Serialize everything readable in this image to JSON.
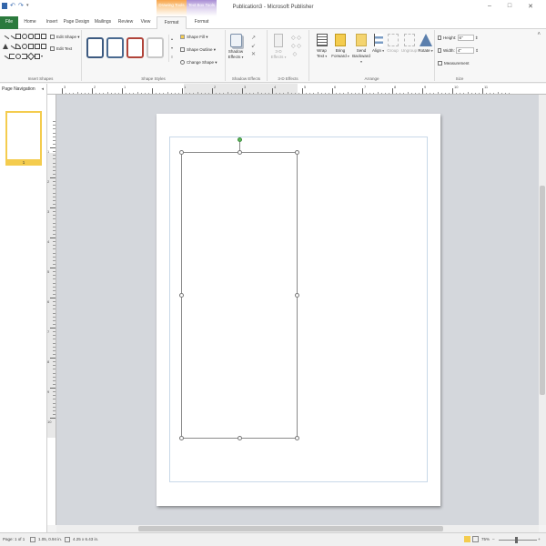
{
  "window": {
    "title": "Publication3 - Microsoft Publisher",
    "contextual_tabs": [
      "Drawing Tools",
      "Text Box Tools"
    ],
    "controls": [
      "minimize-icon",
      "restore-icon",
      "close-icon"
    ]
  },
  "tabs": [
    {
      "label": "File"
    },
    {
      "label": "Home"
    },
    {
      "label": "Insert"
    },
    {
      "label": "Page Design"
    },
    {
      "label": "Mailings"
    },
    {
      "label": "Review"
    },
    {
      "label": "View"
    },
    {
      "label": "Format"
    },
    {
      "label": "Format"
    }
  ],
  "ribbon": {
    "insert_shapes": {
      "label": "Insert Shapes",
      "edit_shape": "Edit Shape",
      "edit_text": "Edit Text"
    },
    "shape_styles": {
      "label": "Shape Styles",
      "swatch_colors": [
        "#3d5a80",
        "#4a6a90",
        "#b0443a",
        "#c8c8c8"
      ],
      "shape_fill": "Shape Fill",
      "shape_outline": "Shape Outline",
      "change_shape": "Change Shape"
    },
    "shadow_effects": {
      "label": "Shadow Effects",
      "button": "Shadow Effects"
    },
    "effects_3d": {
      "label": "3-D Effects",
      "button": "3-D Effects"
    },
    "arrange": {
      "label": "Arrange",
      "wrap_text": "Wrap Text",
      "bring_forward": "Bring Forward",
      "send_backward": "Send Backward",
      "align": "Align",
      "group": "Group",
      "ungroup": "Ungroup",
      "rotate": "Rotate"
    },
    "size": {
      "label": "Size",
      "height_label": "Height:",
      "height_value": "6\"",
      "width_label": "Width:",
      "width_value": "4\"",
      "measurement": "Measurement"
    }
  },
  "nav_pane": {
    "title": "Page Navigation",
    "page_number": "1"
  },
  "ruler": {
    "h_labels": [
      "3",
      "2",
      "1",
      "",
      "1",
      "2",
      "3",
      "4",
      "5",
      "6",
      "7",
      "8",
      "9",
      "10",
      "11"
    ],
    "v_labels": [
      "1",
      "2",
      "3",
      "4",
      "5",
      "6",
      "7",
      "8",
      "9",
      "10"
    ]
  },
  "status": {
    "page": "Page: 1 of 1",
    "position": "1.05, 0.94 in.",
    "size": "4.25 x 6.43 in.",
    "zoom": "75%"
  }
}
